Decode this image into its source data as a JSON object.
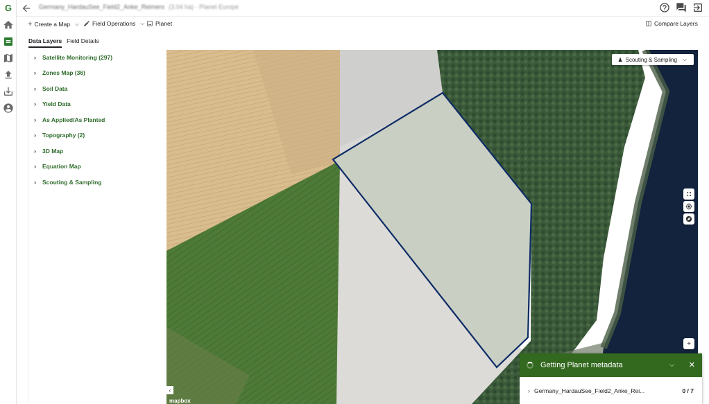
{
  "header": {
    "title": "Germany_HardauSee_Field2_Anke_Reimers",
    "subtitle": "(3.04 ha) · Planet Europe"
  },
  "toolbar": {
    "create_map": "Create a Map",
    "field_operations": "Field Operations",
    "planet": "Planet",
    "compare_layers": "Compare Layers"
  },
  "tabs": [
    {
      "label": "Data Layers",
      "active": true
    },
    {
      "label": "Field Details",
      "active": false
    }
  ],
  "layers": [
    {
      "label": "Satellite Monitoring (297)"
    },
    {
      "label": "Zones Map (36)"
    },
    {
      "label": "Soil Data"
    },
    {
      "label": "Yield Data"
    },
    {
      "label": "As Applied/As Planted"
    },
    {
      "label": "Topography (2)"
    },
    {
      "label": "3D Map"
    },
    {
      "label": "Equation Map"
    },
    {
      "label": "Scouting & Sampling"
    }
  ],
  "map": {
    "scouting_button": "Scouting & Sampling",
    "attribution": "mapbox",
    "boundary_color": "#0d2b66"
  },
  "notification": {
    "title": "Getting Planet metadata",
    "row_label": "Germany_HardauSee_Field2_Anke_Rei...",
    "row_count": "0 / 7",
    "color": "#33691e"
  }
}
